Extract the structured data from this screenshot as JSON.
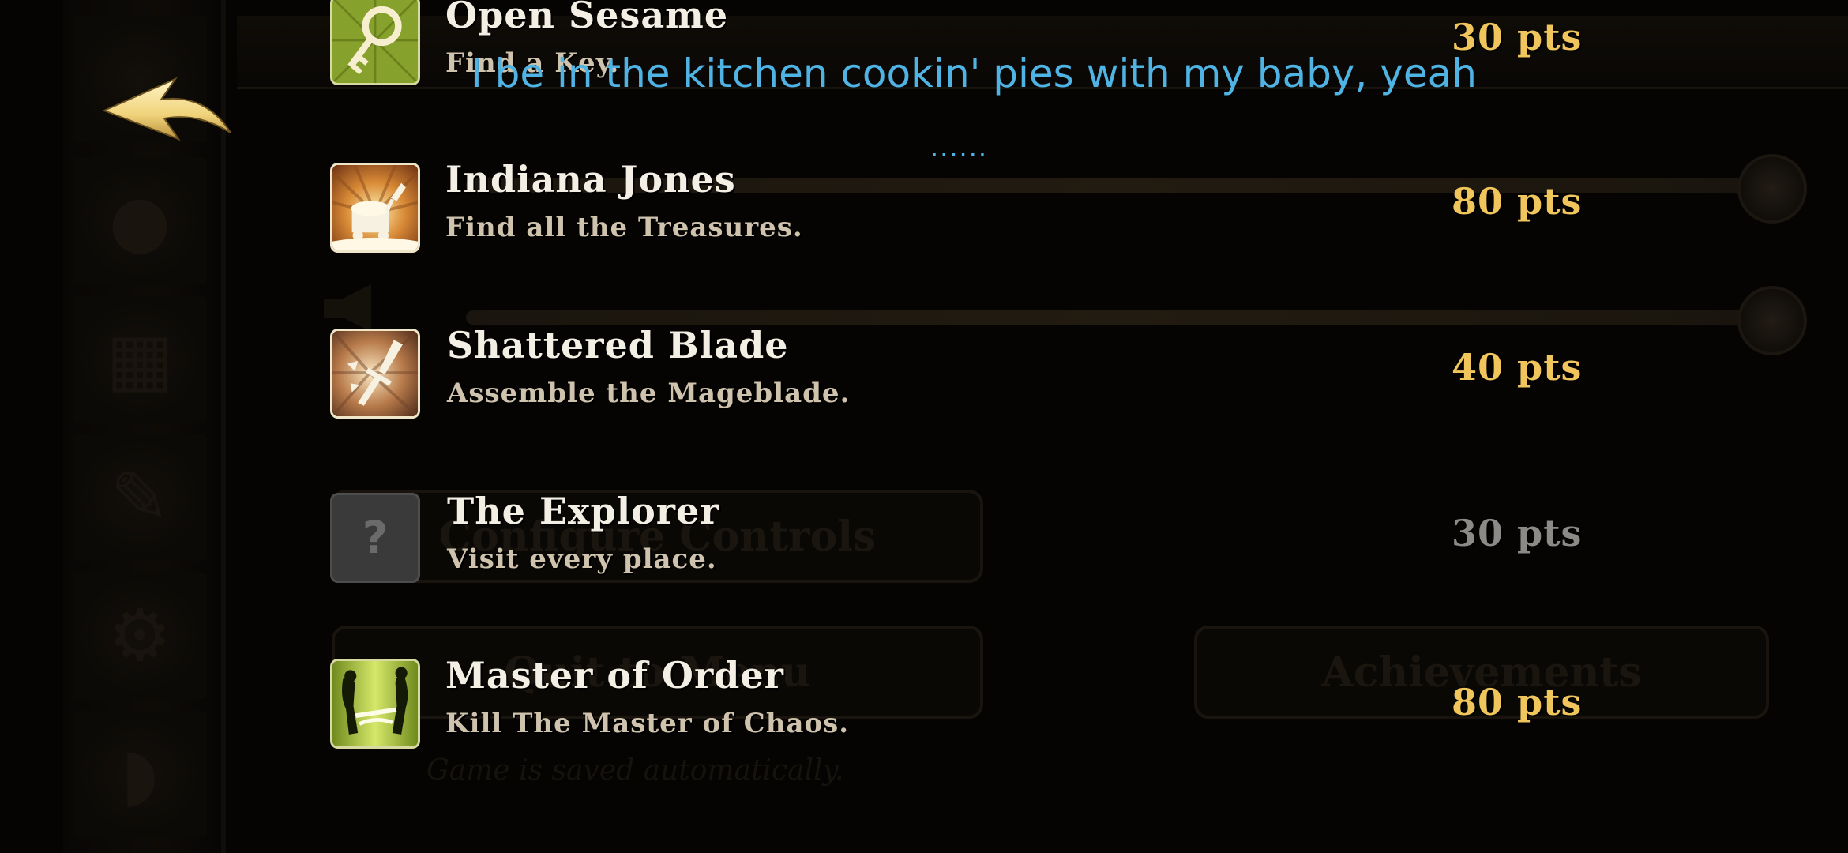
{
  "achievements": [
    {
      "title": "Open Sesame",
      "description": "Find a Key.",
      "points": "30 pts",
      "icon": "key-icon",
      "locked": false
    },
    {
      "title": "Indiana Jones",
      "description": "Find all the Treasures.",
      "points": "80 pts",
      "icon": "treasure-cart-icon",
      "locked": false
    },
    {
      "title": "Shattered Blade",
      "description": "Assemble the Mageblade.",
      "points": "40 pts",
      "icon": "broken-sword-icon",
      "locked": false
    },
    {
      "title": "The Explorer",
      "description": "Visit every place.",
      "points": "30 pts",
      "icon": "question-mark-icon",
      "locked": true,
      "icon_glyph": "?"
    },
    {
      "title": "Master of Order",
      "description": "Kill The Master of Chaos.",
      "points": "80 pts",
      "icon": "duel-silhouette-icon",
      "locked": false
    }
  ],
  "background_menu": {
    "configure_controls_label": "Configure Controls",
    "quit_menu_label": "Quit to Menu",
    "achievements_label": "Achievements",
    "autosave_note": "Game is saved automatically."
  },
  "caption": {
    "text": "I be in the kitchen cookin' pies with my baby, yeah",
    "more": "......"
  },
  "colors": {
    "points_gold": "#efc55c",
    "points_locked": "#8b8a86",
    "caption_blue": "#4fb4e4",
    "title_text": "#f4efe4"
  }
}
